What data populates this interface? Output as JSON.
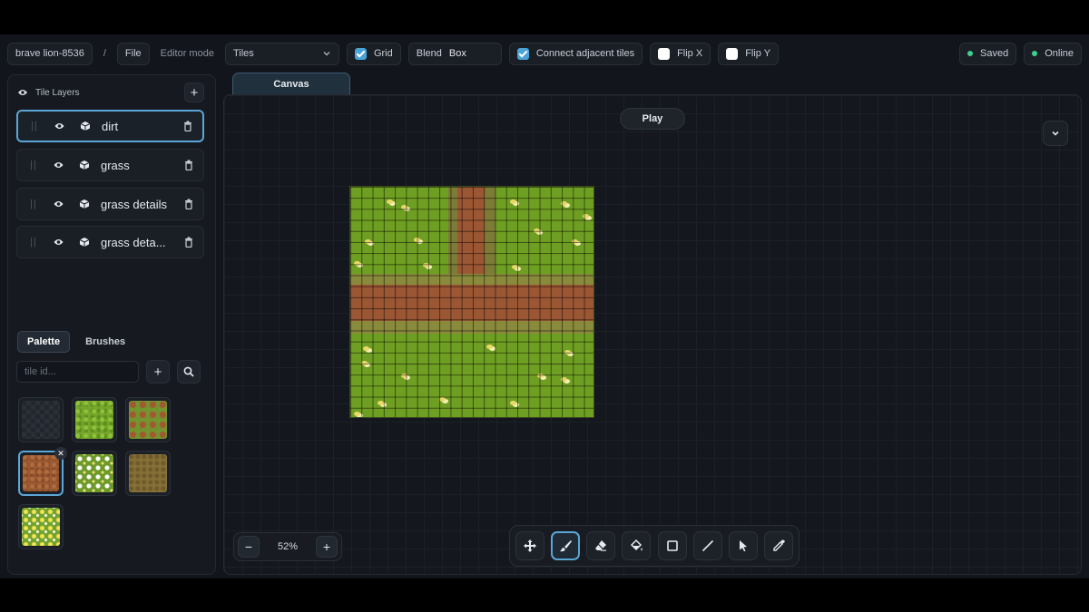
{
  "project_name": "brave lion-8536",
  "separator": "/",
  "file_menu": "File",
  "editor_mode": {
    "label": "Editor mode",
    "value": "Tiles"
  },
  "grid": {
    "label": "Grid",
    "checked": true
  },
  "blend": {
    "label": "Blend",
    "value": "Box"
  },
  "connect_adjacent": {
    "label": "Connect adjacent tiles",
    "checked": true
  },
  "flip_x": {
    "label": "Flip X",
    "checked": false
  },
  "flip_y": {
    "label": "Flip Y",
    "checked": false
  },
  "status": {
    "saved": "Saved",
    "online": "Online",
    "color": "#3ecf8e"
  },
  "layers": {
    "title": "Tile Layers",
    "items": [
      {
        "name": "dirt",
        "active": true
      },
      {
        "name": "grass",
        "active": false
      },
      {
        "name": "grass details",
        "active": false
      },
      {
        "name": "grass deta...",
        "active": false
      }
    ]
  },
  "panel_tabs": {
    "palette": "Palette",
    "brushes": "Brushes",
    "active": "Palette"
  },
  "tile_search": {
    "placeholder": "tile id..."
  },
  "palette_tiles": [
    "empty",
    "grass",
    "grass-dirt",
    "dirt",
    "white-flowers",
    "mud",
    "yellow-flowers"
  ],
  "selected_tile": "dirt",
  "canvas_tab": "Canvas",
  "play_button": "Play",
  "zoom": {
    "value": "52%"
  },
  "tools": [
    "move-icon",
    "brush-icon",
    "eraser-icon",
    "fill-bucket-icon",
    "rectangle-icon",
    "line-icon",
    "select-pointer-icon",
    "eyedropper-icon"
  ],
  "active_tool": "brush-icon",
  "accent_color": "#5aa6d6"
}
